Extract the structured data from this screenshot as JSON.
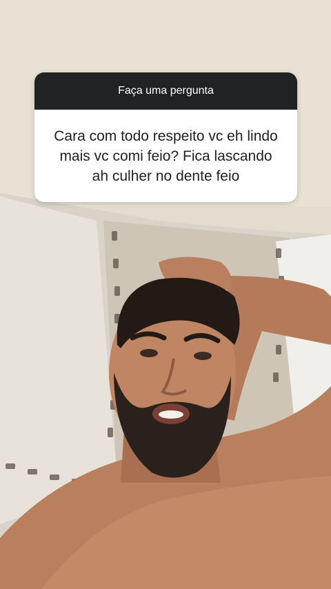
{
  "question_sticker": {
    "header": "Faça uma pergunta",
    "text": "Cara com todo respeito vc eh lindo mais vc comi feio? Fica lascando ah culher no dente feio"
  }
}
